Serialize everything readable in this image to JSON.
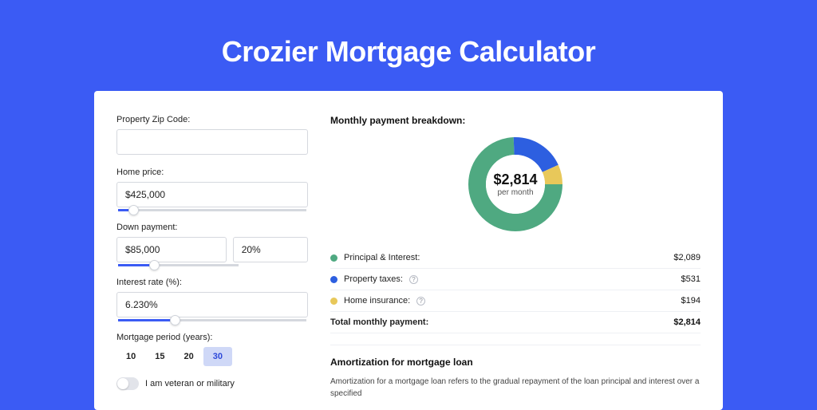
{
  "title": "Crozier Mortgage Calculator",
  "form": {
    "zip_label": "Property Zip Code:",
    "zip_value": "",
    "home_price_label": "Home price:",
    "home_price_value": "$425,000",
    "home_price_slider_pct": 8,
    "down_label": "Down payment:",
    "down_value": "$85,000",
    "down_pct_value": "20%",
    "down_slider_pct": 20,
    "rate_label": "Interest rate (%):",
    "rate_value": "6.230%",
    "rate_slider_pct": 30,
    "period_label": "Mortgage period (years):",
    "periods": [
      "10",
      "15",
      "20",
      "30"
    ],
    "period_selected": "30",
    "veteran_label": "I am veteran or military"
  },
  "breakdown": {
    "title": "Monthly payment breakdown:",
    "donut_amount": "$2,814",
    "donut_sub": "per month",
    "items": [
      {
        "label": "Principal & Interest:",
        "value": "$2,089",
        "has_info": false
      },
      {
        "label": "Property taxes:",
        "value": "$531",
        "has_info": true
      },
      {
        "label": "Home insurance:",
        "value": "$194",
        "has_info": true
      }
    ],
    "total_label": "Total monthly payment:",
    "total_value": "$2,814"
  },
  "amort": {
    "title": "Amortization for mortgage loan",
    "text": "Amortization for a mortgage loan refers to the gradual repayment of the loan principal and interest over a specified"
  },
  "chart_data": {
    "type": "pie",
    "title": "Monthly payment breakdown",
    "series": [
      {
        "name": "Principal & Interest",
        "value": 2089,
        "color": "#4fa981"
      },
      {
        "name": "Property taxes",
        "value": 531,
        "color": "#2d5fe0"
      },
      {
        "name": "Home insurance",
        "value": 194,
        "color": "#e8c85a"
      }
    ],
    "total": 2814,
    "center_label": "$2,814 per month"
  }
}
